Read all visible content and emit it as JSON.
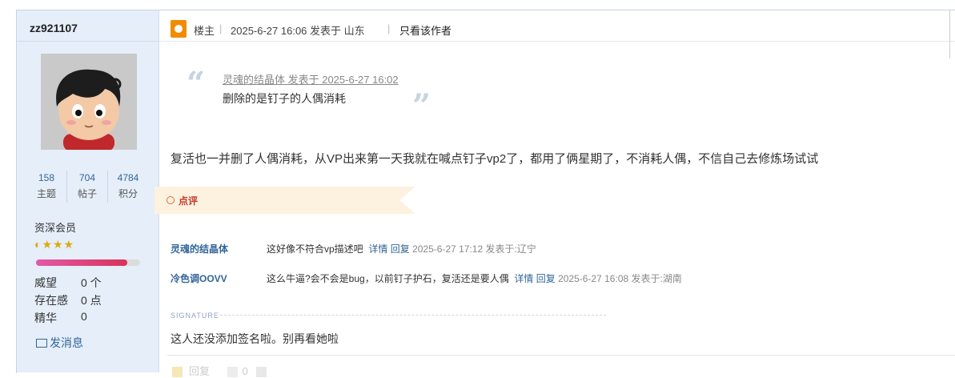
{
  "author": {
    "username": "zz921107",
    "stats": [
      {
        "num": "158",
        "label": "主题"
      },
      {
        "num": "704",
        "label": "帖子"
      },
      {
        "num": "4784",
        "label": "积分"
      }
    ],
    "group": "资深会员",
    "stars": "◐★★★",
    "progress": 0.88,
    "info": [
      {
        "label": "威望",
        "value": "0 个"
      },
      {
        "label": "存在感",
        "value": "0 点"
      },
      {
        "label": "精华",
        "value": "0"
      }
    ],
    "pm_label": "发消息"
  },
  "post": {
    "role": "楼主",
    "divider": "|",
    "posted": "2025-6-27 16:06 发表于 山东",
    "divider2": "|",
    "only_author": "只看该作者",
    "quote_open": "“",
    "quote_close": "”",
    "quote_head": "灵魂的结晶体 发表于 2025-6-27 16:02",
    "quote_text": "删除的是钉子的人偶消耗",
    "body": "复活也一并删了人偶消耗，从VP出来第一天我就在喊点钉子vp2了，都用了俩星期了，不消耗人偶，不信自己去修炼场试试",
    "comments_label": "点评",
    "comments": [
      {
        "author": "灵魂的结晶体",
        "text": "这好像不符合vp描述吧",
        "detail": "详情",
        "reply": "回复",
        "meta": "2025-6-27 17:12 发表于:辽宁"
      },
      {
        "author": "冷色调OOVV",
        "text": "这么牛逼?会不会是bug，以前钉子护石，复活还是要人偶",
        "detail": "详情",
        "reply": "回复",
        "meta": "2025-6-27 16:08 发表于:湖南"
      }
    ],
    "signature_label": "SIGNATURE",
    "signature": "这人还没添加签名啦。别再看她啦",
    "reply_label": "回复",
    "like_count": "0"
  }
}
